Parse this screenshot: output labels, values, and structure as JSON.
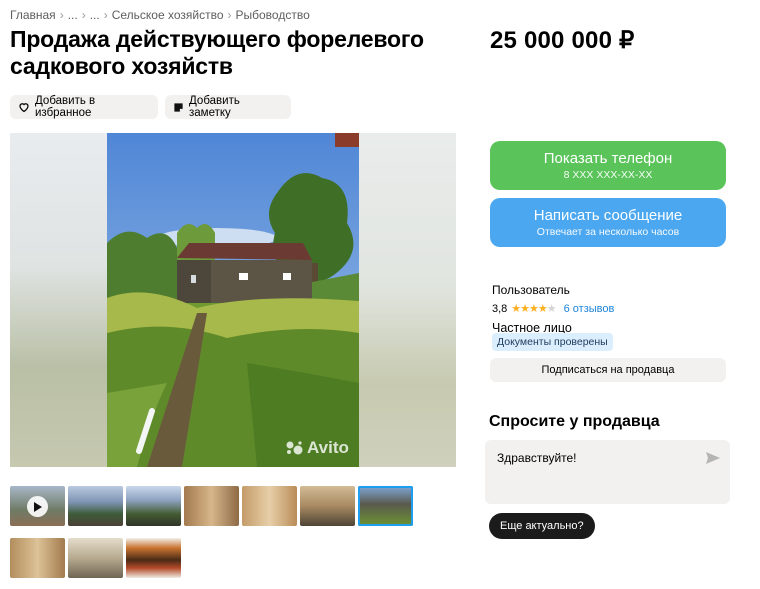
{
  "breadcrumb": {
    "items": [
      "Главная",
      "...",
      "...",
      "Сельское хозяйство",
      "Рыбоводство"
    ],
    "separator": "›"
  },
  "listing": {
    "title": "Продажа действующего форелевого садкового хозяйств",
    "price": "25 000 000 ₽"
  },
  "actions": {
    "favorite_label": "Добавить в избранное",
    "note_label": "Добавить заметку"
  },
  "gallery": {
    "watermark": "Avito",
    "thumbnail_count": 10,
    "active_thumbnail": 7
  },
  "contact": {
    "phone_label": "Показать телефон",
    "phone_mask": "8 XXX XXX-XX-XX",
    "message_label": "Написать сообщение",
    "message_sub": "Отвечает за несколько часов"
  },
  "seller": {
    "name": "Пользователь",
    "rating": "3,8",
    "stars_filled": 4,
    "reviews": "6 отзывов",
    "type": "Частное лицо",
    "badge": "Документы проверены",
    "subscribe_label": "Подписаться на продавца"
  },
  "ask": {
    "title": "Спросите у продавца",
    "message": "Здравствуйте!",
    "quick_reply": "Еще актуально?"
  },
  "colors": {
    "phone_button": "#5ac45a",
    "message_button": "#4aa7f0",
    "review_link": "#1e85d8",
    "star": "#ffb021"
  }
}
